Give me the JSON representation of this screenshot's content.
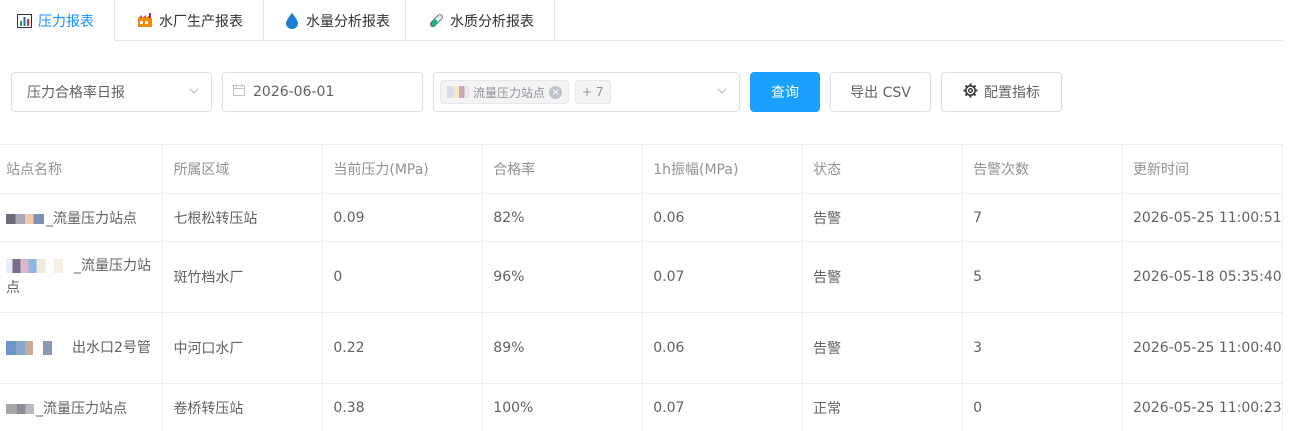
{
  "tabs": [
    {
      "label": "压力报表",
      "icon": "bar-chart-icon",
      "active": true
    },
    {
      "label": "水厂生产报表",
      "icon": "factory-icon",
      "active": false
    },
    {
      "label": "水量分析报表",
      "icon": "water-drop-icon",
      "active": false
    },
    {
      "label": "水质分析报表",
      "icon": "test-tube-icon",
      "active": false
    }
  ],
  "filters": {
    "report_type": "压力合格率日报",
    "date": "2026-06-01",
    "station_tag": "流量压力站点",
    "more_count": "+ 7"
  },
  "actions": {
    "query": "查询",
    "export": "导出 CSV",
    "config": "配置指标"
  },
  "table": {
    "columns": [
      "站点名称",
      "所属区域",
      "当前压力(MPa)",
      "合格率",
      "1h振幅(MPa)",
      "状态",
      "告警次数",
      "更新时间"
    ],
    "rows": [
      {
        "name": "_流量压力站点",
        "region": "七根松转压站",
        "pressure": "0.09",
        "rate": "82%",
        "amplitude": "0.06",
        "status": "告警",
        "alarms": "7",
        "updated": "2026-05-25 11:00:51"
      },
      {
        "name": "_流量压力站点",
        "region": "斑竹档水厂",
        "pressure": "0",
        "rate": "96%",
        "amplitude": "0.07",
        "status": "告警",
        "alarms": "5",
        "updated": "2026-05-18 05:35:40"
      },
      {
        "name": "出水口2号管",
        "region": "中河口水厂",
        "pressure": "0.22",
        "rate": "89%",
        "amplitude": "0.06",
        "status": "告警",
        "alarms": "3",
        "updated": "2026-05-25 11:00:40"
      },
      {
        "name": "_流量压力站点",
        "region": "卷桥转压站",
        "pressure": "0.38",
        "rate": "100%",
        "amplitude": "0.07",
        "status": "正常",
        "alarms": "0",
        "updated": "2026-05-25 11:00:23"
      }
    ]
  },
  "colors": {
    "accent": "#1aa0ff",
    "alarm": "#e00000",
    "normal": "#1a7f1a"
  }
}
